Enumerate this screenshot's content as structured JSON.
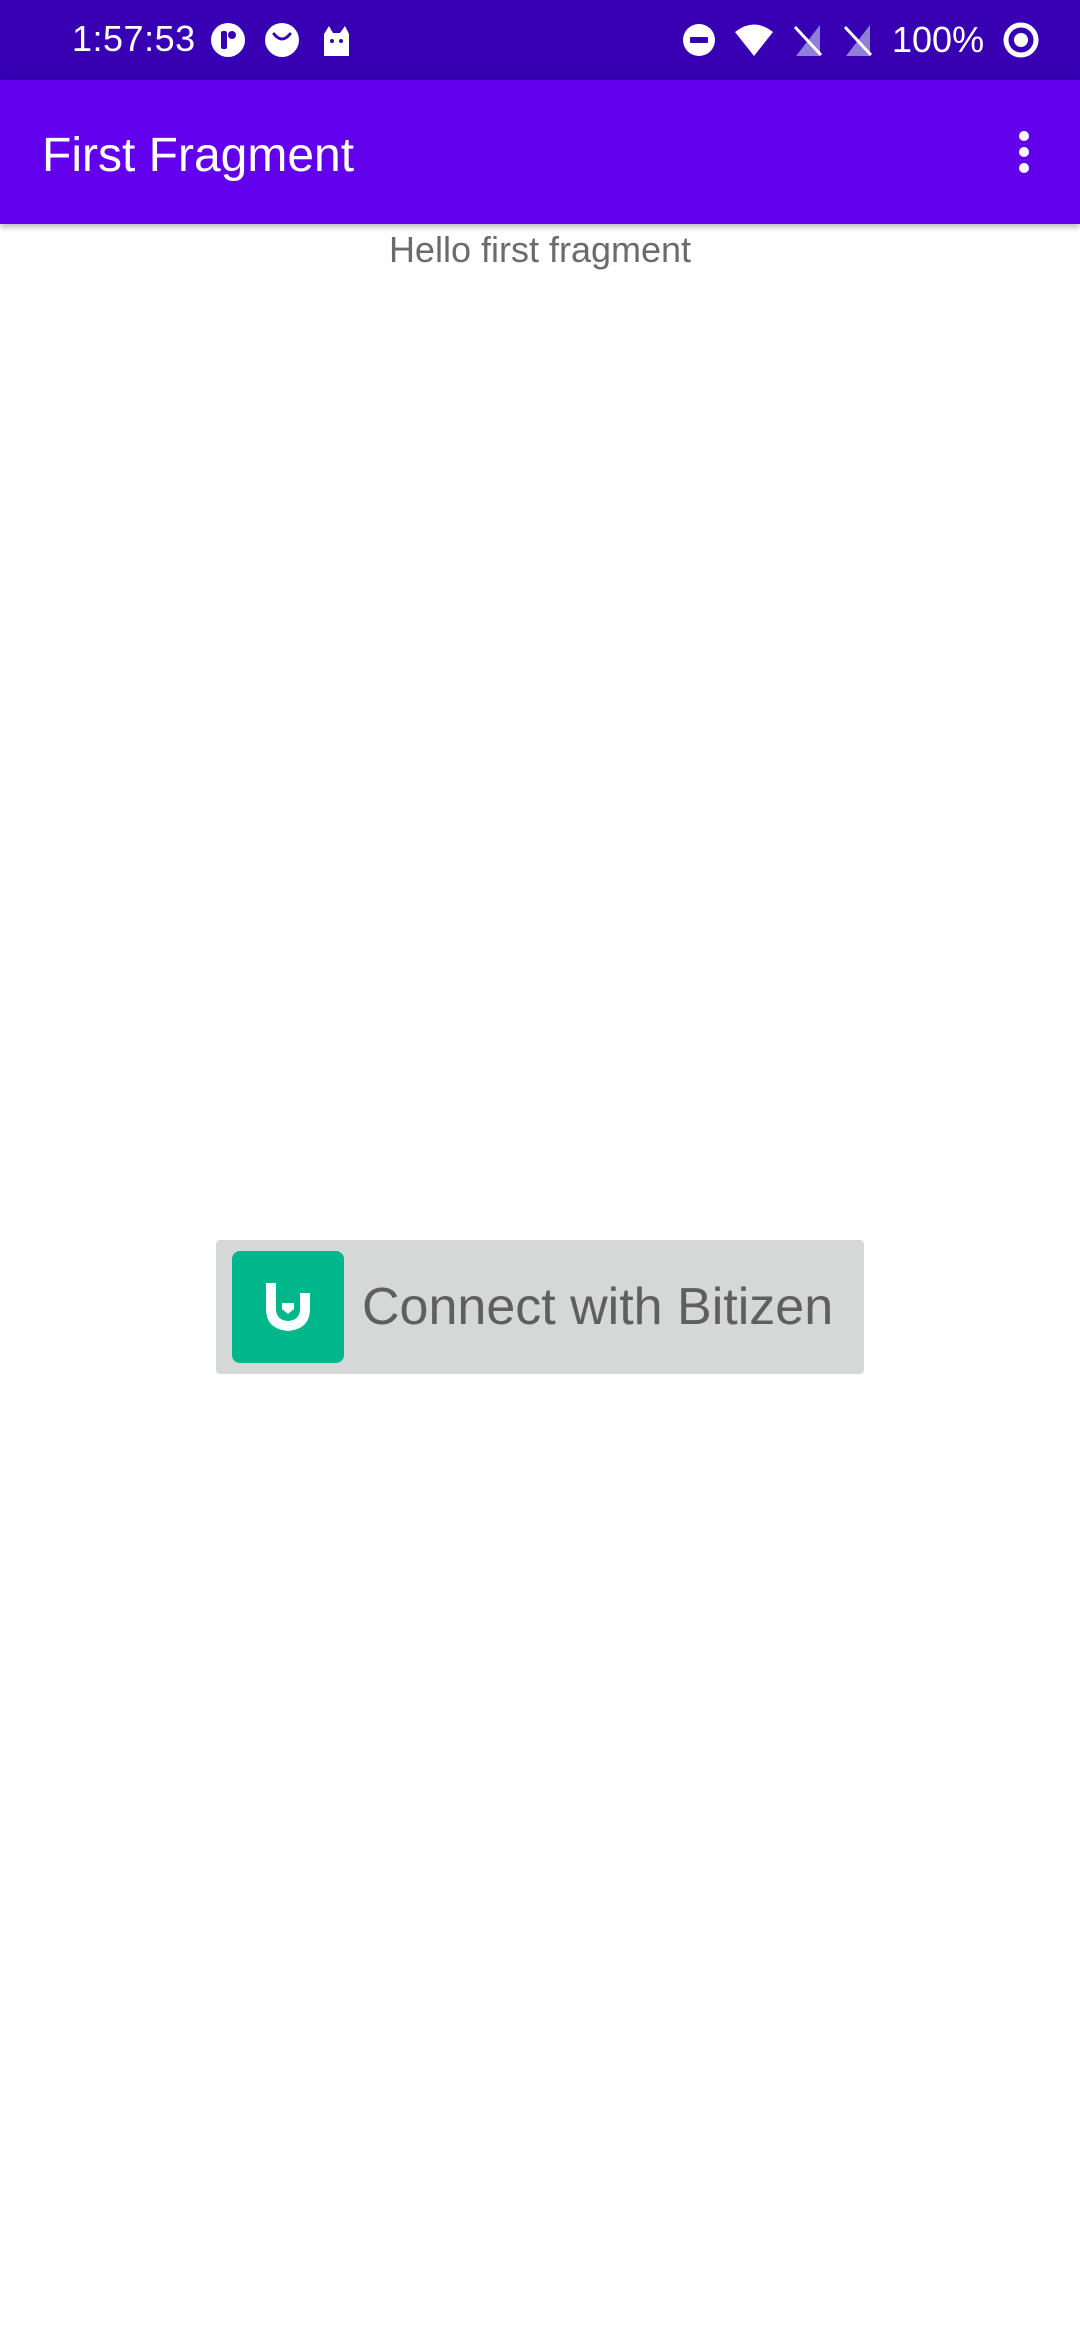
{
  "status_bar": {
    "time": "1:57:53",
    "battery": "100%",
    "left_icons": [
      "notification-app-icon",
      "notification-smile-icon",
      "notification-cat-icon"
    ],
    "right_icons": [
      "do-not-disturb-icon",
      "wifi-icon",
      "no-sim-icon",
      "no-sim-icon",
      "battery-ring-icon"
    ],
    "background_color": "#3700b3"
  },
  "app_bar": {
    "title": "First Fragment",
    "background_color": "#6200ee",
    "overflow_icon": "more-vert-icon"
  },
  "content": {
    "hello_text": "Hello first fragment"
  },
  "connect_button": {
    "label": "Connect with Bitizen",
    "logo_icon": "bitizen-logo-icon",
    "logo_color": "#00b68b",
    "background_color": "#d6d7d7"
  }
}
